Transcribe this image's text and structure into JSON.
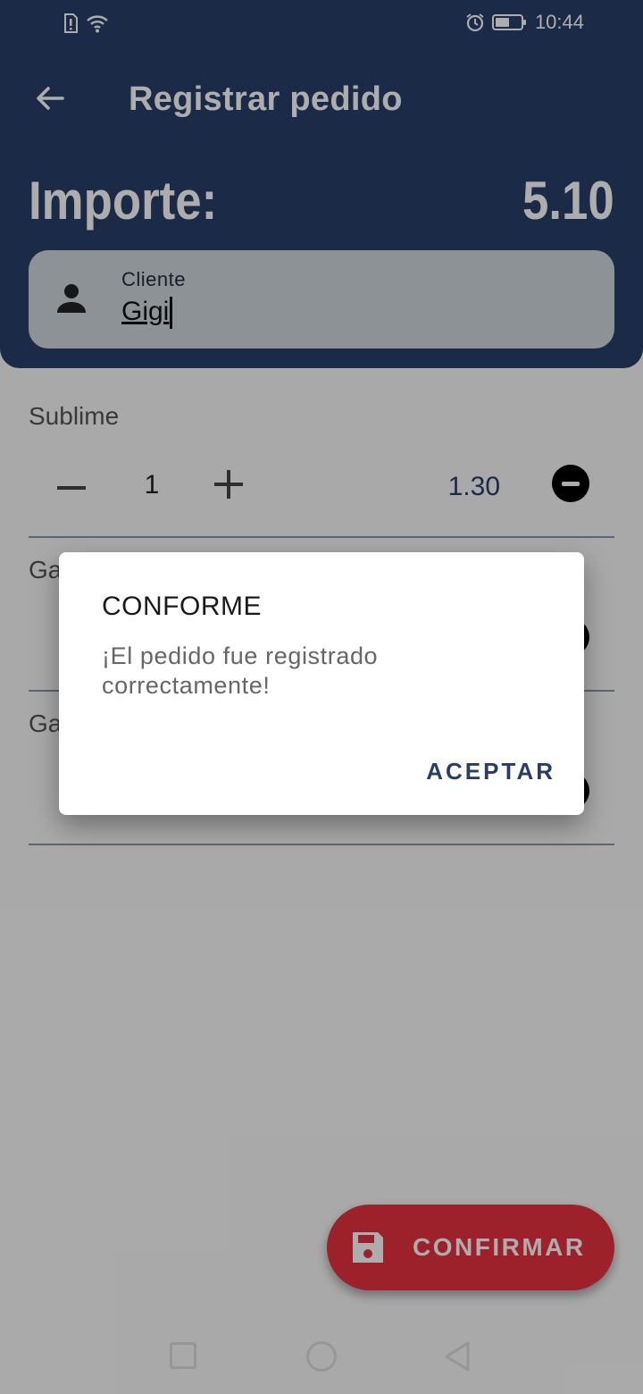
{
  "status_bar": {
    "time": "10:44"
  },
  "app_bar": {
    "title": "Registrar pedido"
  },
  "summary": {
    "amount_label": "Importe:",
    "amount_value": "5.10"
  },
  "client_field": {
    "label": "Cliente",
    "value": "Gigi"
  },
  "items": [
    {
      "name": "Sublime",
      "quantity": "1",
      "price": "1.30"
    },
    {
      "name": "Ga",
      "quantity": "",
      "price": ""
    },
    {
      "name": "Ga",
      "quantity": "",
      "price": ""
    }
  ],
  "fab": {
    "label": "CONFIRMAR"
  },
  "dialog": {
    "title": "CONFORME",
    "message": "¡El pedido fue registrado correctamente!",
    "button": "ACEPTAR"
  },
  "colors": {
    "primary": "#283e68",
    "accent": "#e6323f",
    "client_field_bg": "#cfd8dd"
  }
}
